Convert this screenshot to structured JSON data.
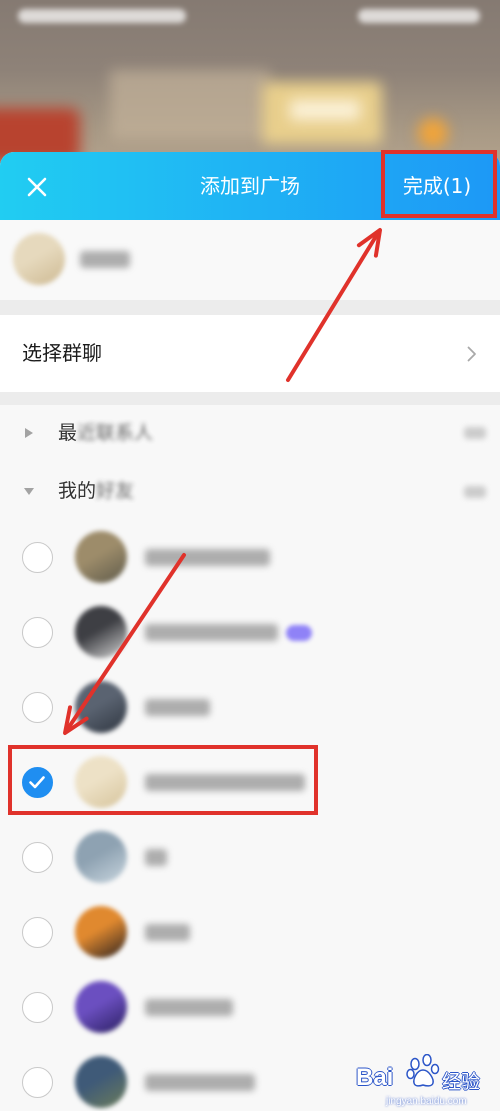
{
  "header": {
    "close_icon": "close-icon",
    "title": "添加到广场",
    "done_label": "完成(1)"
  },
  "selected_strip": {
    "avatar_colors": [
      "#e6d9bd",
      "#cdb992"
    ]
  },
  "select_group_row": {
    "label": "选择群聊",
    "chevron_icon": "chevron-right-icon"
  },
  "groups": [
    {
      "label_sharp": "最",
      "label_blurred": "近联系人",
      "expanded": false,
      "toggle_icon": "triangle-right-icon"
    },
    {
      "label_sharp": "我的",
      "label_blurred": "好友",
      "expanded": true,
      "toggle_icon": "triangle-down-icon"
    }
  ],
  "friends": [
    {
      "selected": false,
      "avatar_colors": [
        "#9d8c6a",
        "#5e5a4a"
      ]
    },
    {
      "selected": false,
      "avatar_colors": [
        "#3e3f44",
        "#d4d4d4"
      ],
      "badge_color": "#8f82f7"
    },
    {
      "selected": false,
      "avatar_colors": [
        "#5a6371",
        "#2f3640"
      ]
    },
    {
      "selected": true,
      "avatar_colors": [
        "#ede1c6",
        "#d6c49c"
      ]
    },
    {
      "selected": false,
      "avatar_colors": [
        "#8ea2b2",
        "#c9d6df"
      ]
    },
    {
      "selected": false,
      "avatar_colors": [
        "#e0892f",
        "#2c2220"
      ]
    },
    {
      "selected": false,
      "avatar_colors": [
        "#6b4fc0",
        "#2a1f60"
      ]
    },
    {
      "selected": false,
      "avatar_colors": [
        "#3f5a78",
        "#6c7d5a"
      ]
    }
  ],
  "theme": {
    "header_gradient_start": "#21cdf2",
    "header_gradient_end": "#1d98f6",
    "check_blue": "#1f8ef1",
    "annotation_red": "#e0322b"
  },
  "watermark": {
    "logo_icon": "baidu-paw-icon",
    "brand_prefix": "Bai",
    "brand_suffix": "经验",
    "url": "jingyan.baidu.com"
  }
}
